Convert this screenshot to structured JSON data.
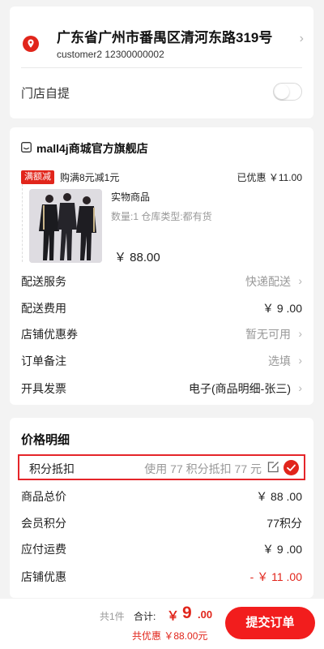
{
  "address": {
    "full": "广东省广州市番禺区清河东路319号",
    "contact": "customer2 12300000002",
    "pickup_label": "门店自提",
    "pickup_enabled": false
  },
  "shop": {
    "name": "mall4j商城官方旗舰店",
    "promo_badge": "满额减",
    "promo_text": "购满8元减1元",
    "promo_saved": "已优惠 ￥11.00",
    "product": {
      "title": "实物商品",
      "spec": "数量:1   仓库类型:都有货",
      "price": "￥ 88.00"
    },
    "rows": [
      {
        "label": "配送服务",
        "value": "快递配送"
      },
      {
        "label": "配送费用",
        "value": "￥ 9 .00"
      },
      {
        "label": "店铺优惠券",
        "value": "暂无可用"
      },
      {
        "label": "订单备注",
        "value": "选填"
      },
      {
        "label": "开具发票",
        "value": "电子(商品明细-张三)"
      }
    ]
  },
  "price_detail": {
    "title": "价格明细",
    "points_label": "积分抵扣",
    "points_value": "使用 77 积分抵扣 77 元",
    "rows": [
      {
        "label": "商品总价",
        "value": "￥ 88 .00"
      },
      {
        "label": "会员积分",
        "value": "77积分"
      },
      {
        "label": "应付运费",
        "value": "￥ 9 .00"
      },
      {
        "label": "店铺优惠",
        "value": "- ￥ 11 .00"
      }
    ]
  },
  "footer": {
    "count": "共1件",
    "total_label": "合计:",
    "total_currency": "￥",
    "total_int": "9",
    "total_dec": ".00",
    "saved": "共优惠 ￥88.00元",
    "submit_label": "提交订单"
  },
  "colors": {
    "accent": "#e1251b",
    "highlight_border": "#e5252a"
  }
}
